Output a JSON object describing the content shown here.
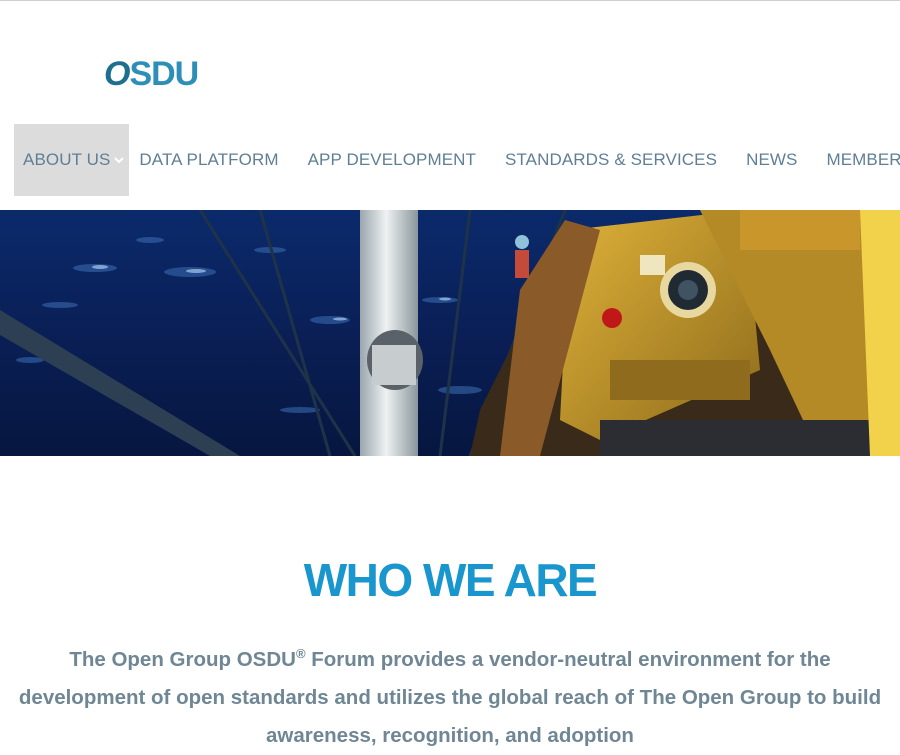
{
  "logo": {
    "o": "O",
    "rest": "SDU"
  },
  "nav": {
    "items": [
      {
        "label": "ABOUT US"
      },
      {
        "label": "DATA PLATFORM"
      },
      {
        "label": "APP DEVELOPMENT"
      },
      {
        "label": "STANDARDS & SERVICES"
      },
      {
        "label": "NEWS"
      },
      {
        "label": "MEMBERSHIP"
      }
    ]
  },
  "colors": {
    "accent": "#1a96cf",
    "nav_text": "#5f7f95",
    "active_bg": "#dcdcdc",
    "body_text": "#6f8694"
  },
  "main": {
    "headline": "WHO WE ARE",
    "intro": {
      "part1": "The Open Group OSDU",
      "reg": "®",
      "part2": " Forum provides a vendor-neutral environment for the development of open standards and utilizes the global reach of The Open Group to build awareness, recognition, and adoption"
    }
  },
  "icons": {
    "dropdown": "chevron-down-icon"
  }
}
